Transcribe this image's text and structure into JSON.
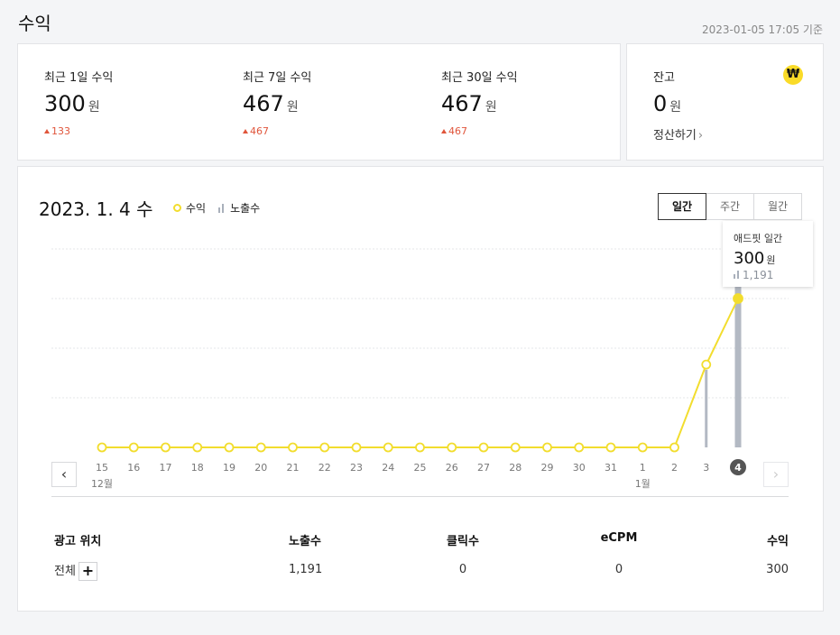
{
  "page": {
    "title": "수익",
    "timestamp": "2023-01-05 17:05 기준"
  },
  "summary": [
    {
      "label": "최근 1일 수익",
      "value": "300",
      "unit": "원",
      "delta": "133"
    },
    {
      "label": "최근 7일 수익",
      "value": "467",
      "unit": "원",
      "delta": "467"
    },
    {
      "label": "최근 30일 수익",
      "value": "467",
      "unit": "원",
      "delta": "467"
    }
  ],
  "balance": {
    "label": "잔고",
    "value": "0",
    "unit": "원",
    "icon_glyph": "₩",
    "icon": "won-icon",
    "link": "정산하기",
    "link_icon": "chevron-right-icon"
  },
  "chart_header": {
    "date": "2023. 1. 4",
    "weekday": "수",
    "legend_revenue": "수익",
    "legend_impressions": "노출수"
  },
  "period_tabs": [
    {
      "label": "일간",
      "active": true
    },
    {
      "label": "주간",
      "active": false
    },
    {
      "label": "월간",
      "active": false
    }
  ],
  "tooltip": {
    "title": "애드핏 일간",
    "value": "300",
    "unit": "원",
    "impressions": "1,191"
  },
  "chart_data": {
    "type": "line",
    "categories": [
      "15",
      "16",
      "17",
      "18",
      "19",
      "20",
      "21",
      "22",
      "23",
      "24",
      "25",
      "26",
      "27",
      "28",
      "29",
      "30",
      "31",
      "1",
      "2",
      "3",
      "4"
    ],
    "month_labels": [
      {
        "index": 0,
        "label": "12월"
      },
      {
        "index": 17,
        "label": "1월"
      }
    ],
    "selected_index": 20,
    "series": [
      {
        "name": "수익",
        "type": "line",
        "values": [
          0,
          0,
          0,
          0,
          0,
          0,
          0,
          0,
          0,
          0,
          0,
          0,
          0,
          0,
          0,
          0,
          0,
          0,
          0,
          167,
          300
        ],
        "color": "#f2dd2e"
      },
      {
        "name": "노출수",
        "type": "bar",
        "values": [
          0,
          0,
          0,
          0,
          0,
          0,
          0,
          0,
          0,
          0,
          0,
          0,
          0,
          0,
          0,
          0,
          0,
          0,
          0,
          520,
          1191
        ],
        "color": "#b3b9c3"
      }
    ],
    "ylim_revenue": [
      0,
      400
    ],
    "ylim_impressions": [
      0,
      1450
    ],
    "grid": true
  },
  "nav": {
    "prev": "‹",
    "next": "›"
  },
  "table": {
    "headers": [
      "광고 위치",
      "노출수",
      "클릭수",
      "eCPM",
      "수익"
    ],
    "rows": [
      {
        "name": "전체",
        "impressions": "1,191",
        "clicks": "0",
        "ecpm": "0",
        "revenue": "300",
        "expand": "+"
      }
    ]
  },
  "colors": {
    "accent": "#f2dd2e",
    "bar": "#b3b9c3",
    "up": "#e0553b"
  }
}
